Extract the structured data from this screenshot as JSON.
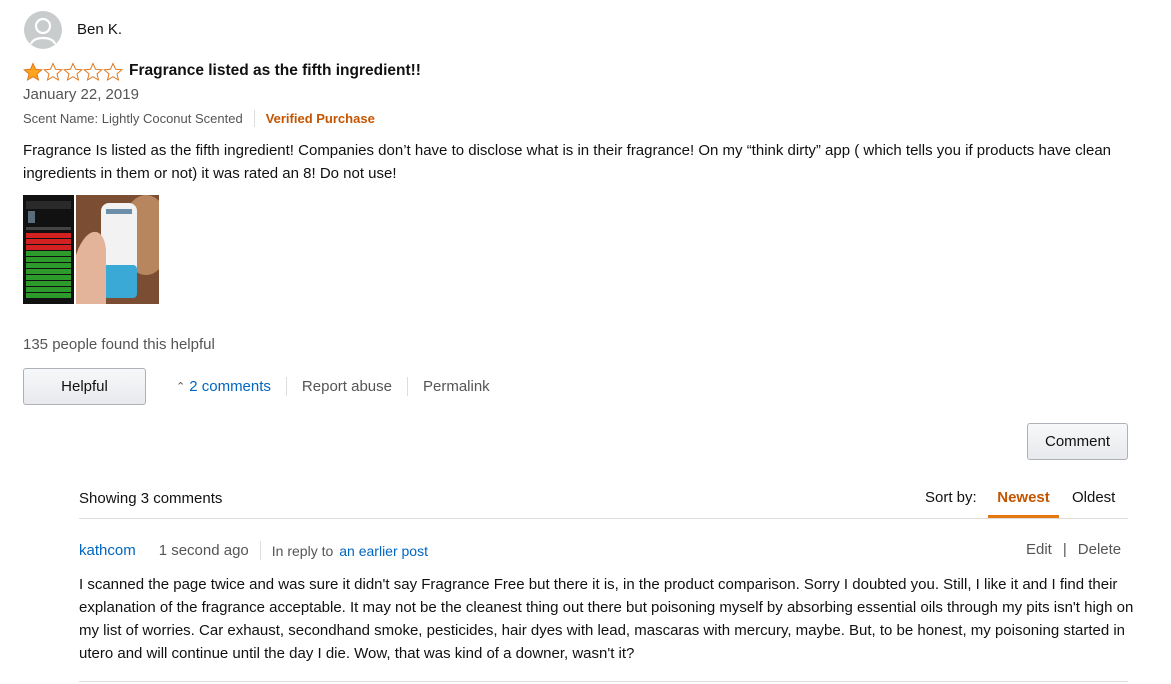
{
  "review": {
    "reviewer_name": "Ben K.",
    "rating": 1,
    "rating_max": 5,
    "title": "Fragrance listed as the fifth ingredient!!",
    "date": "January 22, 2019",
    "scent_label": "Scent Name: Lightly Coconut Scented",
    "verified_label": "Verified Purchase",
    "body": "Fragrance Is listed as the fifth ingredient! Companies don’t have to disclose what is in their fragrance! On my “think dirty” app ( which tells you if products have clean ingredients in them or not) it was rated an 8! Do not use!",
    "helpful_count_text": "135 people found this helpful"
  },
  "actions": {
    "helpful_label": "Helpful",
    "comments_label": "2 comments",
    "report_label": "Report abuse",
    "permalink_label": "Permalink",
    "comment_label": "Comment"
  },
  "comments_section": {
    "showing_label": "Showing 3 comments",
    "sort_by_label": "Sort by:",
    "sort_options": [
      "Newest",
      "Oldest"
    ],
    "selected_sort": "Newest"
  },
  "comment": {
    "author": "kathcom",
    "time": "1 second ago",
    "reply_prefix": "In reply to",
    "reply_link": "an earlier post",
    "edit_label": "Edit",
    "delete_label": "Delete",
    "body": "I scanned the page twice and was sure it didn't say Fragrance Free but there it is, in the product comparison. Sorry I doubted you. Still, I like it and I find their explanation of the fragrance acceptable. It may not be the cleanest thing out there but poisoning myself by absorbing essential oils through my pits isn't high on my list of worries. Car exhaust, secondhand smoke, pesticides, hair dyes with lead, mascaras with mercury, maybe. But, to be honest, my poisoning started in utero and will continue until the day I die. Wow, that was kind of a downer, wasn't it?"
  },
  "colors": {
    "star_fill": "#ffa41c",
    "link": "#0066c0",
    "verified": "#c45500",
    "sort_underline": "#e47911"
  }
}
